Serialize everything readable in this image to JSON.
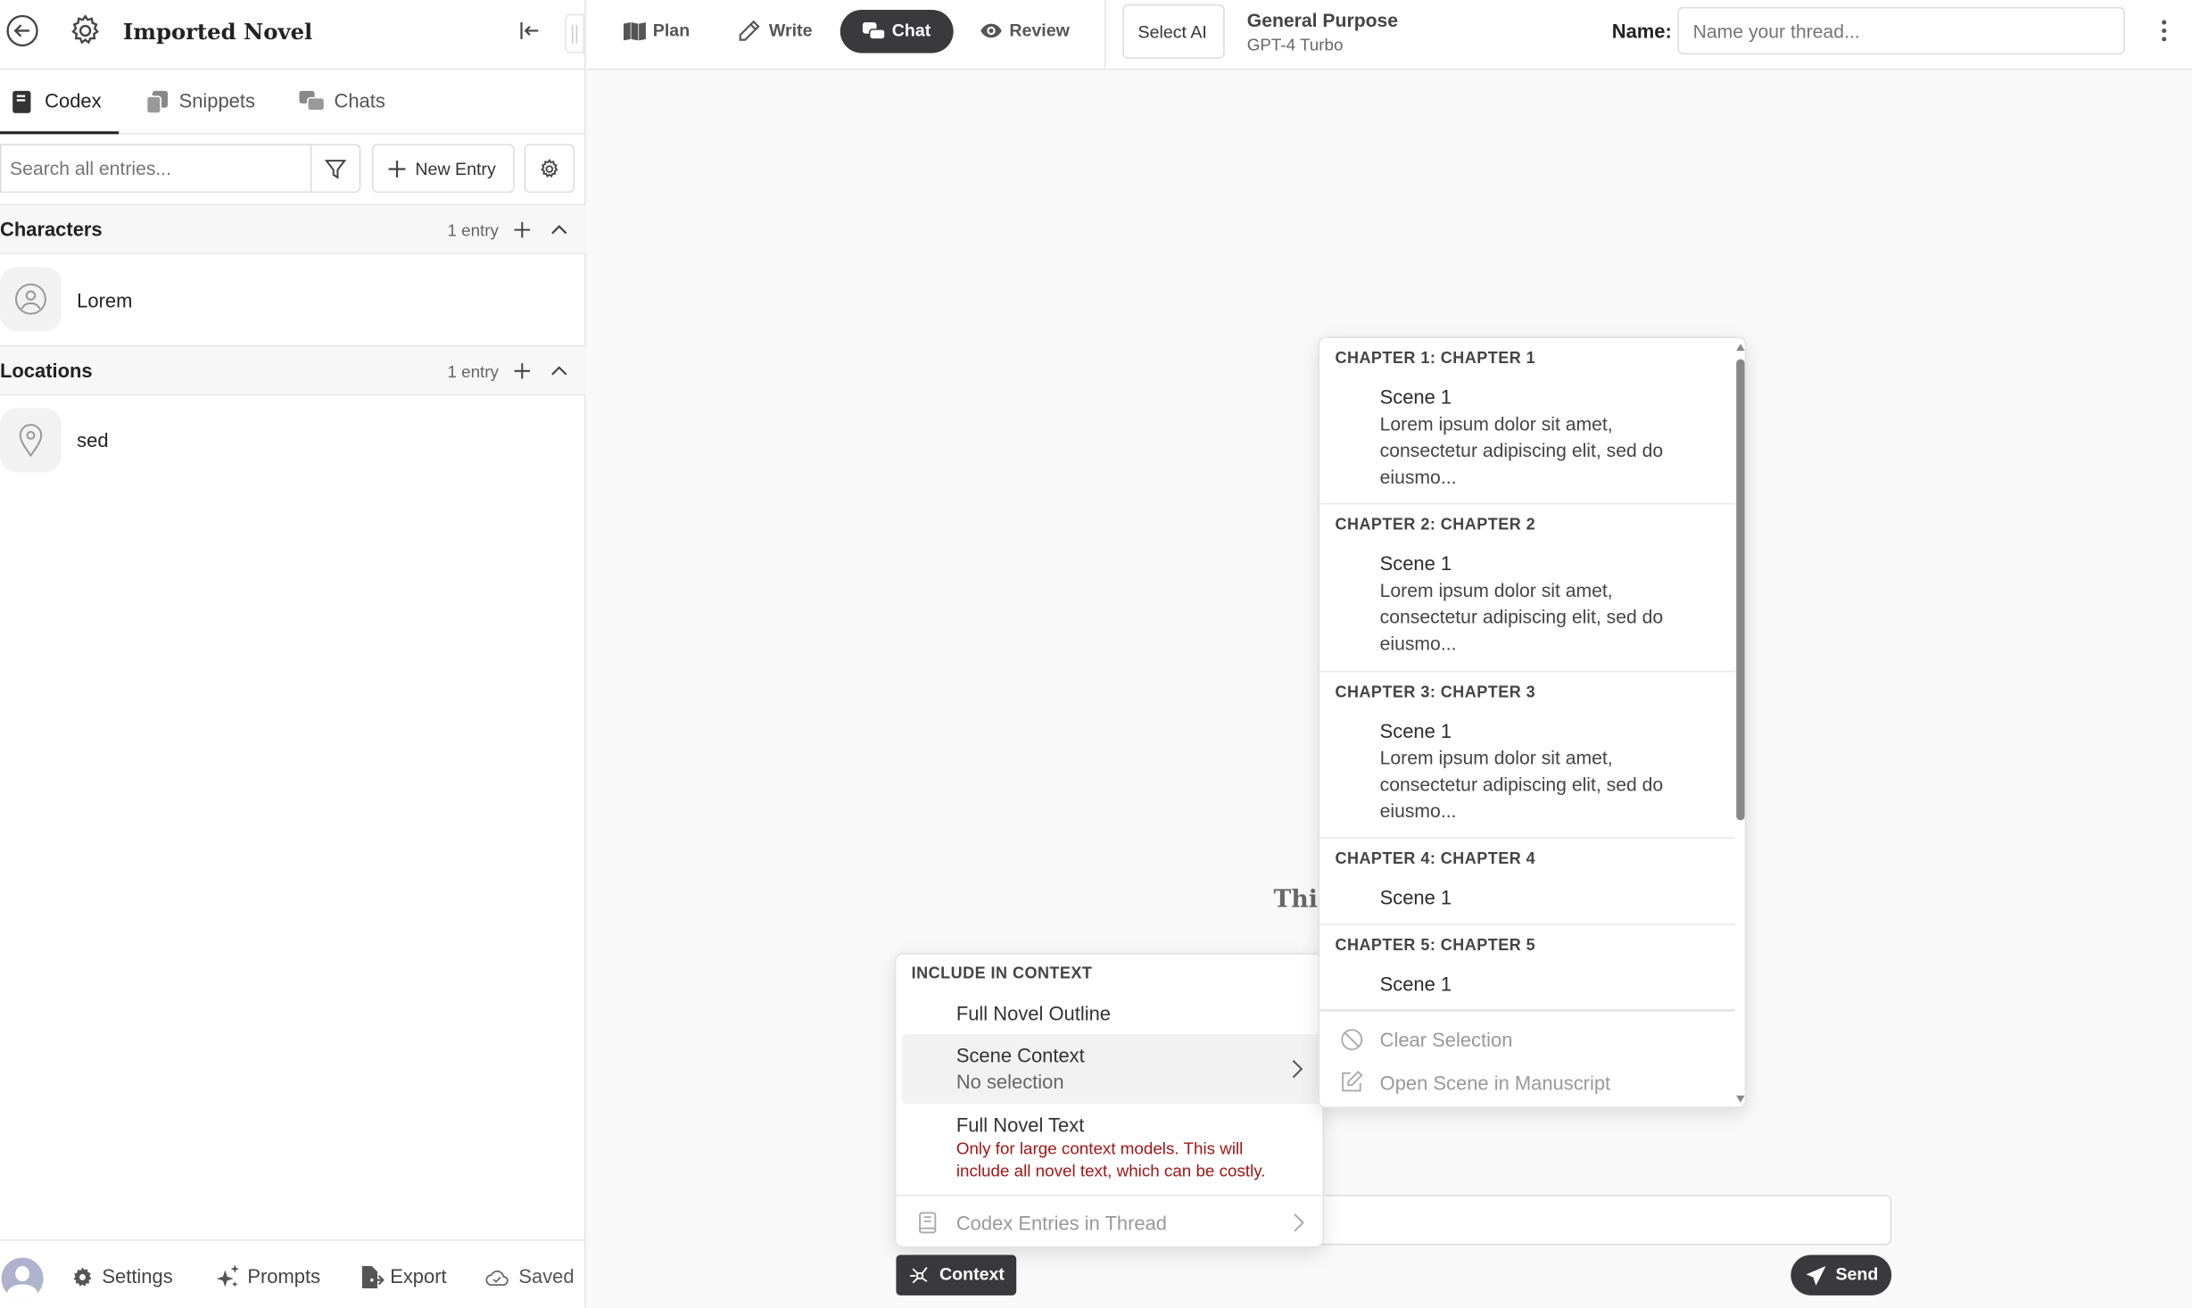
{
  "sidebar": {
    "title": "Imported Novel",
    "tabs": [
      {
        "label": "Codex",
        "icon": "book-icon",
        "active": true
      },
      {
        "label": "Snippets",
        "icon": "snippets-icon"
      },
      {
        "label": "Chats",
        "icon": "chats-icon"
      }
    ],
    "search_placeholder": "Search all entries...",
    "new_entry_label": "New Entry",
    "groups": [
      {
        "title": "Characters",
        "count": "1 entry",
        "items": [
          {
            "name": "Lorem",
            "icon": "person-icon"
          }
        ]
      },
      {
        "title": "Locations",
        "count": "1 entry",
        "items": [
          {
            "name": "sed",
            "icon": "map-pin-icon"
          }
        ]
      }
    ],
    "footer": {
      "settings": "Settings",
      "prompts": "Prompts",
      "export": "Export",
      "saved": "Saved"
    }
  },
  "topbar": {
    "modes": [
      {
        "label": "Plan"
      },
      {
        "label": "Write"
      },
      {
        "label": "Chat",
        "active": true
      },
      {
        "label": "Review"
      }
    ],
    "select_ai": "Select AI",
    "model_name": "General Purpose",
    "model_id": "GPT-4 Turbo",
    "name_label": "Name:",
    "name_placeholder": "Name your thread..."
  },
  "main": {
    "empty_title_partial": "This"
  },
  "scene_dropdown": {
    "chapters": [
      {
        "title": "CHAPTER 1: CHAPTER 1",
        "scene": "Scene 1",
        "desc": "Lorem ipsum dolor sit amet, consectetur adipiscing elit, sed do eiusmo..."
      },
      {
        "title": "CHAPTER 2: CHAPTER 2",
        "scene": "Scene 1",
        "desc": "Lorem ipsum dolor sit amet, consectetur adipiscing elit, sed do eiusmo..."
      },
      {
        "title": "CHAPTER 3: CHAPTER 3",
        "scene": "Scene 1",
        "desc": "Lorem ipsum dolor sit amet, consectetur adipiscing elit, sed do eiusmo..."
      },
      {
        "title": "CHAPTER 4: CHAPTER 4",
        "scene": "Scene 1"
      },
      {
        "title": "CHAPTER 5: CHAPTER 5",
        "scene": "Scene 1"
      }
    ],
    "clear_selection": "Clear Selection",
    "open_scene": "Open Scene in Manuscript"
  },
  "context_menu": {
    "heading": "INCLUDE IN CONTEXT",
    "full_outline": "Full Novel Outline",
    "scene_context": "Scene Context",
    "scene_context_sub": "No selection",
    "full_text": "Full Novel Text",
    "full_text_warning": "Only for large context models. This will include all novel text, which can be costly.",
    "codex_entries": "Codex Entries in Thread"
  },
  "composer": {
    "context_label": "Context",
    "send_label": "Send"
  },
  "colors": {
    "accent_dark": "#3a3a3c",
    "warning": "#a31515",
    "panel_bg": "#f9f9f9"
  }
}
